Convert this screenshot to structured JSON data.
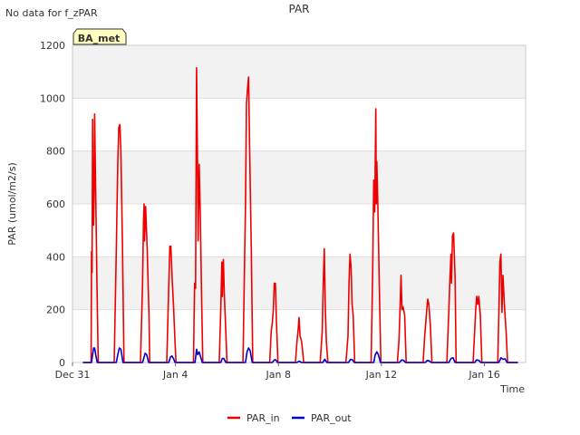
{
  "header": {
    "no_data_note": "No data for f_zPAR"
  },
  "badge": {
    "label": "BA_met"
  },
  "legend": {
    "items": [
      {
        "label": "PAR_in",
        "color": "#ee0000"
      },
      {
        "label": "PAR_out",
        "color": "#0000cc"
      }
    ]
  },
  "chart_data": {
    "type": "line",
    "title": "PAR",
    "xlabel": "Time",
    "ylabel": "PAR (umol/m2/s)",
    "ylim": [
      0,
      1200
    ],
    "y_ticks": [
      0,
      200,
      400,
      600,
      800,
      1000,
      1200
    ],
    "x_unit": "days since Dec 31",
    "xlim": [
      0,
      17.6
    ],
    "x_ticks": [
      {
        "label": "Dec 31",
        "value": 0
      },
      {
        "label": "Jan 4",
        "value": 4
      },
      {
        "label": "Jan 8",
        "value": 8
      },
      {
        "label": "Jan 12",
        "value": 12
      },
      {
        "label": "Jan 16",
        "value": 16
      }
    ],
    "grid": true,
    "legend_position": "bottom",
    "series": [
      {
        "name": "PAR_in",
        "color": "#ee0000",
        "points": [
          [
            0.4,
            0
          ],
          [
            0.72,
            0
          ],
          [
            0.74,
            420
          ],
          [
            0.76,
            340
          ],
          [
            0.78,
            920
          ],
          [
            0.8,
            600
          ],
          [
            0.82,
            520
          ],
          [
            0.84,
            660
          ],
          [
            0.86,
            940
          ],
          [
            0.9,
            640
          ],
          [
            0.95,
            300
          ],
          [
            1.0,
            0
          ],
          [
            1.62,
            0
          ],
          [
            1.7,
            420
          ],
          [
            1.76,
            760
          ],
          [
            1.8,
            890
          ],
          [
            1.84,
            900
          ],
          [
            1.88,
            800
          ],
          [
            1.94,
            450
          ],
          [
            2.0,
            0
          ],
          [
            2.64,
            0
          ],
          [
            2.72,
            300
          ],
          [
            2.76,
            540
          ],
          [
            2.78,
            600
          ],
          [
            2.8,
            460
          ],
          [
            2.84,
            590
          ],
          [
            2.9,
            430
          ],
          [
            2.97,
            180
          ],
          [
            3.0,
            0
          ],
          [
            3.66,
            0
          ],
          [
            3.74,
            300
          ],
          [
            3.78,
            440
          ],
          [
            3.82,
            440
          ],
          [
            3.88,
            300
          ],
          [
            3.92,
            220
          ],
          [
            3.98,
            80
          ],
          [
            4.02,
            0
          ],
          [
            4.7,
            0
          ],
          [
            4.74,
            300
          ],
          [
            4.78,
            280
          ],
          [
            4.82,
            1115
          ],
          [
            4.86,
            700
          ],
          [
            4.88,
            460
          ],
          [
            4.92,
            750
          ],
          [
            4.96,
            580
          ],
          [
            5.02,
            220
          ],
          [
            5.06,
            0
          ],
          [
            5.7,
            0
          ],
          [
            5.76,
            200
          ],
          [
            5.8,
            380
          ],
          [
            5.82,
            250
          ],
          [
            5.86,
            390
          ],
          [
            5.9,
            250
          ],
          [
            5.94,
            150
          ],
          [
            6.0,
            0
          ],
          [
            6.62,
            0
          ],
          [
            6.72,
            600
          ],
          [
            6.76,
            980
          ],
          [
            6.8,
            1040
          ],
          [
            6.84,
            1080
          ],
          [
            6.88,
            800
          ],
          [
            6.94,
            450
          ],
          [
            7.0,
            0
          ],
          [
            7.66,
            0
          ],
          [
            7.72,
            120
          ],
          [
            7.76,
            150
          ],
          [
            7.8,
            200
          ],
          [
            7.84,
            300
          ],
          [
            7.88,
            300
          ],
          [
            7.92,
            160
          ],
          [
            7.98,
            0
          ],
          [
            8.66,
            0
          ],
          [
            8.72,
            80
          ],
          [
            8.76,
            120
          ],
          [
            8.8,
            170
          ],
          [
            8.84,
            100
          ],
          [
            8.9,
            80
          ],
          [
            8.94,
            40
          ],
          [
            8.98,
            0
          ],
          [
            9.62,
            0
          ],
          [
            9.7,
            120
          ],
          [
            9.74,
            300
          ],
          [
            9.78,
            430
          ],
          [
            9.82,
            200
          ],
          [
            9.86,
            80
          ],
          [
            9.92,
            0
          ],
          [
            10.62,
            0
          ],
          [
            10.7,
            100
          ],
          [
            10.74,
            300
          ],
          [
            10.78,
            410
          ],
          [
            10.82,
            360
          ],
          [
            10.86,
            220
          ],
          [
            10.9,
            180
          ],
          [
            10.96,
            0
          ],
          [
            11.6,
            0
          ],
          [
            11.66,
            360
          ],
          [
            11.7,
            690
          ],
          [
            11.74,
            570
          ],
          [
            11.78,
            960
          ],
          [
            11.8,
            600
          ],
          [
            11.82,
            760
          ],
          [
            11.86,
            600
          ],
          [
            11.92,
            280
          ],
          [
            11.98,
            0
          ],
          [
            12.62,
            0
          ],
          [
            12.68,
            80
          ],
          [
            12.72,
            200
          ],
          [
            12.76,
            330
          ],
          [
            12.8,
            200
          ],
          [
            12.84,
            210
          ],
          [
            12.9,
            180
          ],
          [
            12.96,
            0
          ],
          [
            13.62,
            0
          ],
          [
            13.68,
            100
          ],
          [
            13.72,
            150
          ],
          [
            13.76,
            200
          ],
          [
            13.8,
            240
          ],
          [
            13.84,
            220
          ],
          [
            13.9,
            140
          ],
          [
            13.96,
            0
          ],
          [
            14.54,
            0
          ],
          [
            14.62,
            200
          ],
          [
            14.66,
            320
          ],
          [
            14.7,
            410
          ],
          [
            14.72,
            300
          ],
          [
            14.76,
            480
          ],
          [
            14.8,
            490
          ],
          [
            14.86,
            320
          ],
          [
            14.9,
            0
          ],
          [
            15.56,
            0
          ],
          [
            15.62,
            120
          ],
          [
            15.66,
            200
          ],
          [
            15.7,
            250
          ],
          [
            15.74,
            220
          ],
          [
            15.78,
            250
          ],
          [
            15.84,
            180
          ],
          [
            15.9,
            0
          ],
          [
            16.52,
            0
          ],
          [
            16.6,
            380
          ],
          [
            16.64,
            410
          ],
          [
            16.68,
            190
          ],
          [
            16.72,
            330
          ],
          [
            16.78,
            210
          ],
          [
            16.84,
            120
          ],
          [
            16.9,
            0
          ],
          [
            17.3,
            0
          ]
        ]
      },
      {
        "name": "PAR_out",
        "color": "#0000cc",
        "points": [
          [
            0.4,
            0
          ],
          [
            0.74,
            0
          ],
          [
            0.78,
            30
          ],
          [
            0.82,
            55
          ],
          [
            0.86,
            55
          ],
          [
            0.9,
            30
          ],
          [
            0.96,
            0
          ],
          [
            1.7,
            0
          ],
          [
            1.76,
            30
          ],
          [
            1.82,
            55
          ],
          [
            1.88,
            50
          ],
          [
            1.96,
            0
          ],
          [
            2.72,
            0
          ],
          [
            2.78,
            20
          ],
          [
            2.82,
            35
          ],
          [
            2.88,
            30
          ],
          [
            2.96,
            0
          ],
          [
            3.74,
            0
          ],
          [
            3.8,
            20
          ],
          [
            3.86,
            25
          ],
          [
            3.92,
            15
          ],
          [
            3.98,
            0
          ],
          [
            4.76,
            0
          ],
          [
            4.82,
            50
          ],
          [
            4.86,
            30
          ],
          [
            4.92,
            40
          ],
          [
            4.98,
            20
          ],
          [
            5.04,
            0
          ],
          [
            5.76,
            0
          ],
          [
            5.82,
            15
          ],
          [
            5.88,
            15
          ],
          [
            5.96,
            0
          ],
          [
            6.72,
            0
          ],
          [
            6.78,
            40
          ],
          [
            6.84,
            55
          ],
          [
            6.9,
            45
          ],
          [
            6.98,
            0
          ],
          [
            7.76,
            0
          ],
          [
            7.84,
            10
          ],
          [
            7.9,
            10
          ],
          [
            7.96,
            0
          ],
          [
            8.72,
            0
          ],
          [
            8.8,
            5
          ],
          [
            8.9,
            0
          ],
          [
            9.72,
            0
          ],
          [
            9.8,
            12
          ],
          [
            9.88,
            0
          ],
          [
            10.72,
            0
          ],
          [
            10.8,
            12
          ],
          [
            10.88,
            10
          ],
          [
            10.94,
            0
          ],
          [
            11.7,
            0
          ],
          [
            11.76,
            30
          ],
          [
            11.82,
            40
          ],
          [
            11.88,
            30
          ],
          [
            11.96,
            0
          ],
          [
            12.7,
            0
          ],
          [
            12.78,
            10
          ],
          [
            12.86,
            8
          ],
          [
            12.94,
            0
          ],
          [
            13.7,
            0
          ],
          [
            13.78,
            8
          ],
          [
            13.86,
            6
          ],
          [
            13.94,
            0
          ],
          [
            14.62,
            0
          ],
          [
            14.7,
            15
          ],
          [
            14.78,
            18
          ],
          [
            14.86,
            0
          ],
          [
            15.62,
            0
          ],
          [
            15.7,
            10
          ],
          [
            15.78,
            8
          ],
          [
            15.86,
            0
          ],
          [
            16.56,
            0
          ],
          [
            16.64,
            18
          ],
          [
            16.72,
            12
          ],
          [
            16.8,
            14
          ],
          [
            16.88,
            0
          ],
          [
            17.3,
            0
          ]
        ]
      }
    ]
  }
}
